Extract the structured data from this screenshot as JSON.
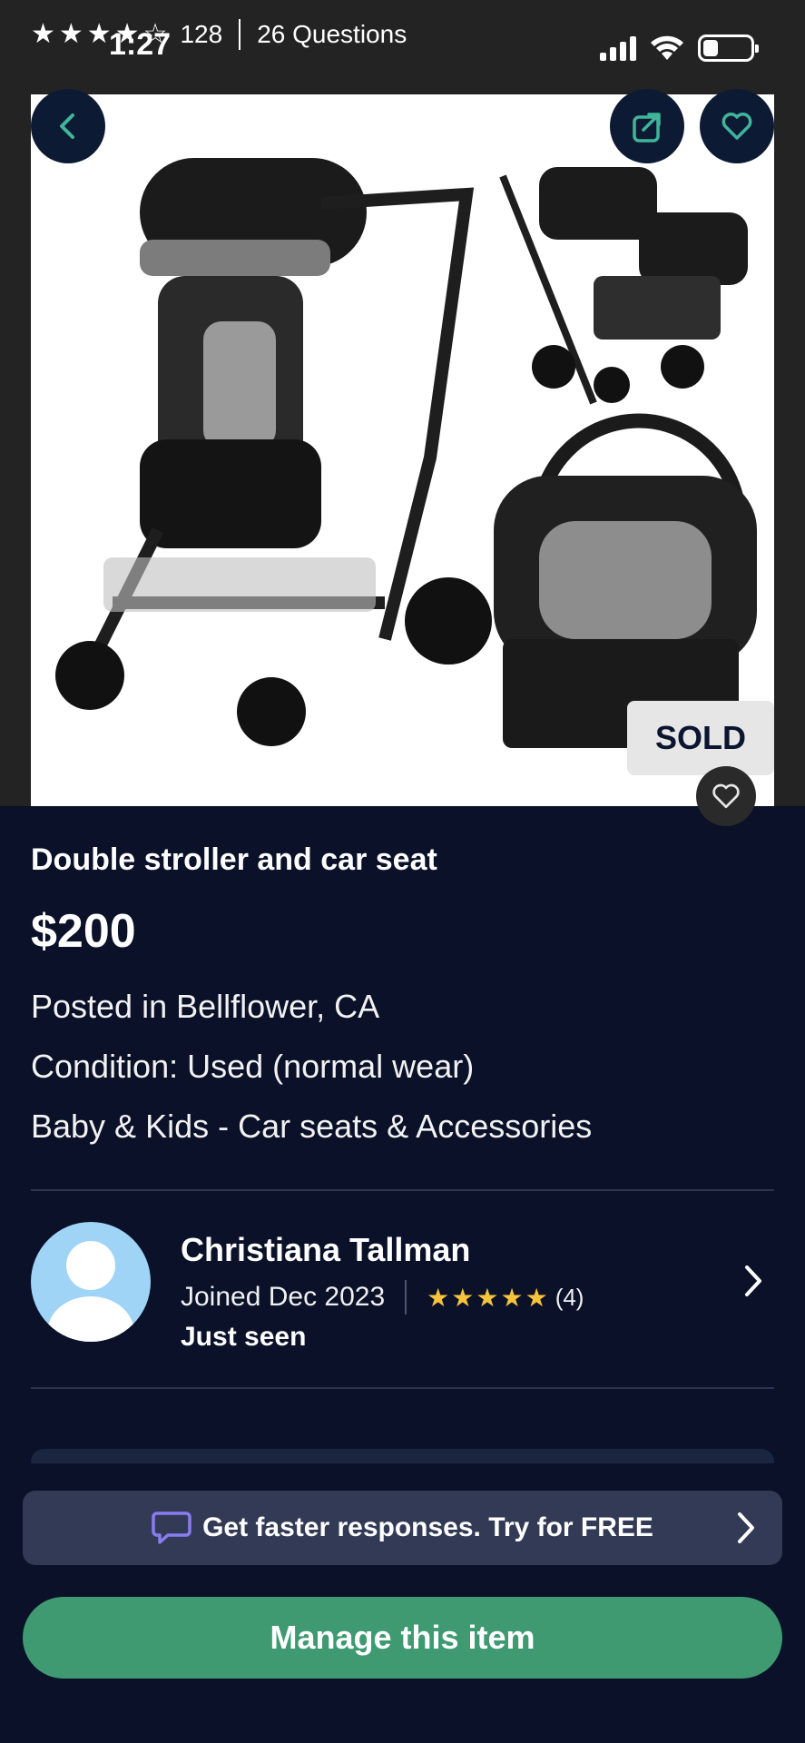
{
  "status_bar": {
    "time": "1:27"
  },
  "header": {
    "rating_stars": "★★★★☆",
    "rating_count": "128",
    "questions": "26 Questions"
  },
  "image": {
    "badge": "SOLD"
  },
  "listing": {
    "title": "Double stroller and car seat",
    "price": "$200",
    "location": "Posted in Bellflower, CA",
    "condition": "Condition: Used (normal wear)",
    "category": "Baby & Kids - Car seats & Accessories"
  },
  "seller": {
    "name": "Christiana Tallman",
    "joined": "Joined Dec 2023",
    "stars": "★★★★★",
    "review_count": "(4)",
    "presence": "Just seen"
  },
  "promo": {
    "text": "Get faster responses.  Try for FREE"
  },
  "actions": {
    "manage_label": "Manage this item"
  },
  "colors": {
    "background": "#0a1128",
    "accent_green": "#3f9a72",
    "star_gold": "#f6c33b",
    "promo_bg": "#323a55"
  }
}
